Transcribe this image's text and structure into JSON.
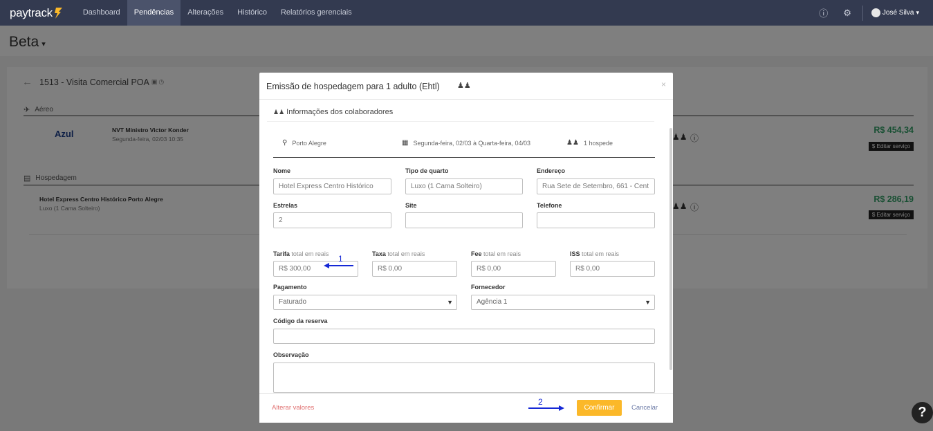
{
  "nav": {
    "brand": "paytrack",
    "links": [
      "Dashboard",
      "Pendências",
      "Alterações",
      "Histórico",
      "Relatórios gerenciais"
    ],
    "user": "José Silva"
  },
  "page": {
    "company": "Beta"
  },
  "trip": {
    "title": "1513 - Visita Comercial POA",
    "aereo_label": "Aéreo",
    "airline": "Azul",
    "flight_title": "NVT Ministro Victor Konder",
    "flight_date": "Segunda-feira, 02/03 10:35",
    "flight_price": "R$ 454,34",
    "hotel_label": "Hospedagem",
    "hotel_title": "Hotel Express Centro Histórico Porto Alegre",
    "hotel_sub": "Luxo (1 Cama Solteiro)",
    "hotel_price": "R$ 286,19",
    "edit_label": "$ Editar serviço"
  },
  "modal": {
    "title": "Emissão de hospedagem para 1 adulto (Ehtl)",
    "section": "Informações dos colaboradores",
    "city": "Porto Alegre",
    "dates": "Segunda-feira, 02/03 à Quarta-feira, 04/03",
    "guests": "1 hospede",
    "labels": {
      "nome": "Nome",
      "tipo": "Tipo de quarto",
      "endereco": "Endereço",
      "estrelas": "Estrelas",
      "site": "Site",
      "telefone": "Telefone",
      "tarifa": "Tarifa",
      "taxa": "Taxa",
      "fee": "Fee",
      "iss": "ISS",
      "hint": "total em reais",
      "pagamento": "Pagamento",
      "fornecedor": "Fornecedor",
      "codigo": "Código da reserva",
      "obs": "Observação"
    },
    "values": {
      "nome": "Hotel Express Centro Histórico",
      "tipo": "Luxo (1 Cama Solteiro)",
      "endereco": "Rua Sete de Setembro, 661 - Cent",
      "estrelas": "2",
      "site": "",
      "telefone": "",
      "tarifa": "R$ 300,00",
      "taxa": "R$ 0,00",
      "fee": "R$ 0,00",
      "iss": "R$ 0,00",
      "pagamento": "Faturado",
      "fornecedor": "Agência 1",
      "codigo": ""
    },
    "footer": {
      "alter": "Alterar valores",
      "confirm": "Confirmar",
      "cancel": "Cancelar"
    }
  },
  "annotations": {
    "one": "1",
    "two": "2"
  },
  "help": "?"
}
